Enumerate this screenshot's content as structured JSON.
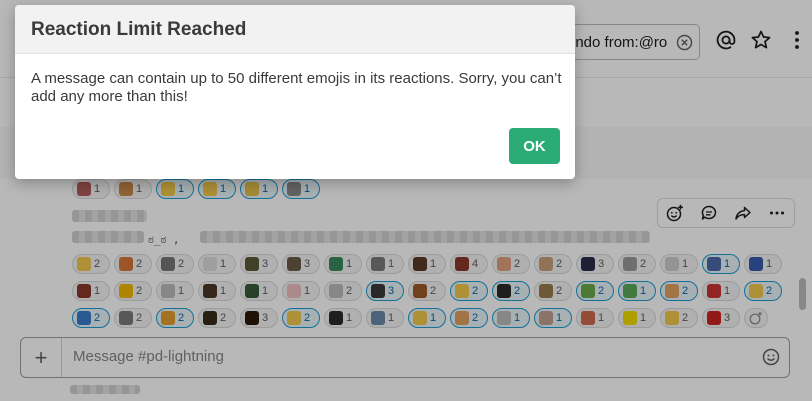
{
  "header": {
    "search_value": "endo from:@ro"
  },
  "composer": {
    "placeholder": "Message #pd-lightning"
  },
  "message": {
    "ascii_text": "ಠ_ಠ ,"
  },
  "reaction_rows": [
    [
      {
        "color": "#b35c5c",
        "count": "1"
      },
      {
        "color": "#c98a4a",
        "count": "1"
      },
      {
        "color": "#f2c94c",
        "count": "1",
        "mine": true
      },
      {
        "color": "#f2c94c",
        "count": "1",
        "mine": true
      },
      {
        "color": "#e6c34a",
        "count": "1",
        "mine": true
      },
      {
        "color": "#8a8a8a",
        "count": "1",
        "mine": true
      }
    ],
    [
      {
        "color": "#f2c94c",
        "count": "2"
      },
      {
        "color": "#d9773a",
        "count": "2"
      },
      {
        "color": "#777777",
        "count": "2"
      },
      {
        "color": "#dddddd",
        "count": "1"
      },
      {
        "color": "#5a5a3a",
        "count": "3"
      },
      {
        "color": "#6a5a4a",
        "count": "3"
      },
      {
        "color": "#3a8a5a",
        "count": "1"
      },
      {
        "color": "#7a7a7a",
        "count": "1"
      },
      {
        "color": "#5a3a2a",
        "count": "1"
      },
      {
        "color": "#8a3a2a",
        "count": "4"
      },
      {
        "color": "#e0a080",
        "count": "2"
      },
      {
        "color": "#c9a07a",
        "count": "2"
      },
      {
        "color": "#2a2a4a",
        "count": "3"
      },
      {
        "color": "#9a9a9a",
        "count": "2"
      },
      {
        "color": "#cccccc",
        "count": "1"
      },
      {
        "color": "#4a6aaa",
        "count": "1",
        "mine": true
      },
      {
        "color": "#3a5aaa",
        "count": "1"
      }
    ],
    [
      {
        "color": "#8a3a2a",
        "count": "1"
      },
      {
        "color": "#f2b800",
        "count": "2"
      },
      {
        "color": "#bbbbbb",
        "count": "1"
      },
      {
        "color": "#4a3a2a",
        "count": "1"
      },
      {
        "color": "#3a5a3a",
        "count": "1"
      },
      {
        "color": "#f0c0c0",
        "count": "1"
      },
      {
        "color": "#bbbbbb",
        "count": "2"
      },
      {
        "color": "#3a3a3a",
        "count": "3",
        "mine": true
      },
      {
        "color": "#9a5a2a",
        "count": "2"
      },
      {
        "color": "#f2c94c",
        "count": "2",
        "mine": true
      },
      {
        "color": "#2a2a2a",
        "count": "2",
        "mine": true
      },
      {
        "color": "#9a7a4a",
        "count": "2"
      },
      {
        "color": "#6aaa4a",
        "count": "2",
        "mine": true
      },
      {
        "color": "#5aaa5a",
        "count": "1",
        "mine": true
      },
      {
        "color": "#e0a060",
        "count": "2",
        "mine": true
      },
      {
        "color": "#cc3333",
        "count": "1"
      },
      {
        "color": "#f2c94c",
        "count": "2",
        "mine": true
      }
    ],
    [
      {
        "color": "#3a7acc",
        "count": "2",
        "mine": true
      },
      {
        "color": "#7a7a7a",
        "count": "2"
      },
      {
        "color": "#e0a030",
        "count": "2",
        "mine": true
      },
      {
        "color": "#3a2a1a",
        "count": "2"
      },
      {
        "color": "#2a1a0a",
        "count": "3"
      },
      {
        "color": "#f2c94c",
        "count": "2",
        "mine": true
      },
      {
        "color": "#2a2a2a",
        "count": "1"
      },
      {
        "color": "#6a8aaa",
        "count": "1"
      },
      {
        "color": "#f2c94c",
        "count": "1",
        "mine": true
      },
      {
        "color": "#e0a060",
        "count": "2",
        "mine": true
      },
      {
        "color": "#bbbbbb",
        "count": "1",
        "mine": true
      },
      {
        "color": "#c0a090",
        "count": "1",
        "mine": true
      },
      {
        "color": "#cc6a4a",
        "count": "1"
      },
      {
        "color": "#f2dc00",
        "count": "1"
      },
      {
        "color": "#f2c94c",
        "count": "2"
      },
      {
        "color": "#cc2222",
        "count": "3"
      }
    ]
  ],
  "modal": {
    "title": "Reaction Limit Reached",
    "body": "A message can contain up to 50 different emojis in its reactions. Sorry, you can’t add any more than this!",
    "ok_label": "OK"
  }
}
